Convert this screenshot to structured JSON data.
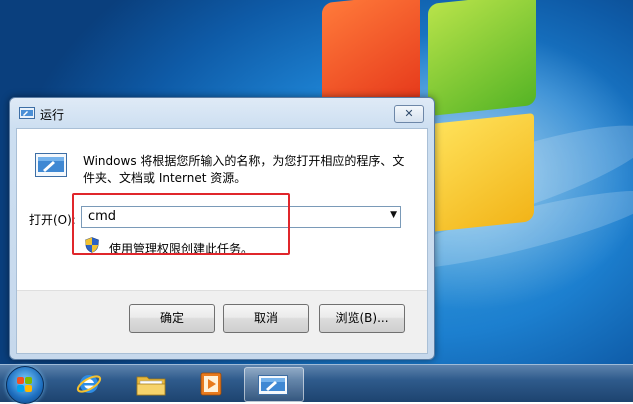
{
  "dialog": {
    "title": "运行",
    "close_symbol": "✕",
    "description": "Windows 将根据您所输入的名称，为您打开相应的程序、文件夹、文档或 Internet 资源。",
    "open_label": "打开(O):",
    "open_value": "cmd",
    "admin_note": "使用管理权限创建此任务。",
    "buttons": {
      "ok": "确定",
      "cancel": "取消",
      "browse": "浏览(B)..."
    },
    "icons": {
      "title": "run-icon",
      "body": "run-icon",
      "admin": "uac-shield-icon",
      "dropdown": "chevron-down-icon"
    }
  },
  "taskbar": {
    "items": [
      {
        "name": "start-button",
        "icon": "windows-logo-icon"
      },
      {
        "name": "internet-explorer",
        "icon": "ie-icon"
      },
      {
        "name": "windows-explorer",
        "icon": "folder-icon"
      },
      {
        "name": "media-player",
        "icon": "media-player-icon"
      },
      {
        "name": "run-dialog-task",
        "icon": "run-icon",
        "active": true
      }
    ]
  },
  "colors": {
    "highlight_box": "#e0262b",
    "desktop_blue": "#1c7fcf",
    "taskbar": "#2f5b8c"
  }
}
